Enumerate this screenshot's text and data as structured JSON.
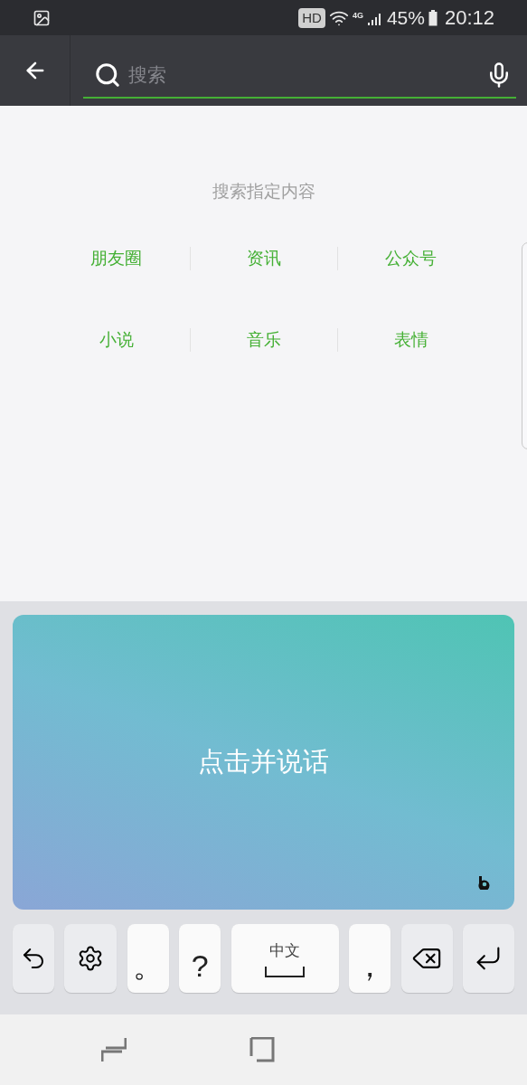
{
  "status_bar": {
    "hd": "HD",
    "network": "4G",
    "battery": "45%",
    "time": "20:12"
  },
  "search": {
    "placeholder": "搜索"
  },
  "hint": "搜索指定内容",
  "categories": [
    {
      "label": "朋友圈"
    },
    {
      "label": "资讯"
    },
    {
      "label": "公众号"
    },
    {
      "label": "小说"
    },
    {
      "label": "音乐"
    },
    {
      "label": "表情"
    }
  ],
  "voice_panel": {
    "label": "点击并说话"
  },
  "keys": [
    {
      "kind": "undo"
    },
    {
      "kind": "settings"
    },
    {
      "kind": "char",
      "label": "。"
    },
    {
      "kind": "char",
      "label": "?"
    },
    {
      "kind": "space",
      "label": "中文"
    },
    {
      "kind": "char",
      "label": "，"
    },
    {
      "kind": "backspace"
    },
    {
      "kind": "enter"
    }
  ]
}
